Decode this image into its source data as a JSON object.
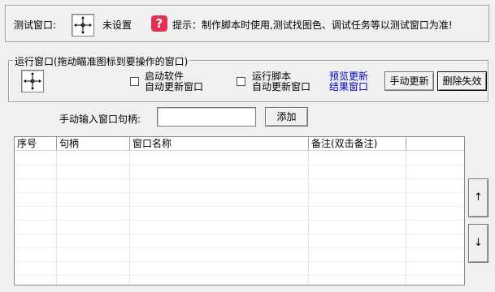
{
  "top": {
    "test_window_label": "测试窗口:",
    "crosshair_icon": "crosshair-icon",
    "not_set_text": "未设置",
    "help_icon": "question-icon",
    "help_icon_glyph": "?",
    "help_icon_color": "#e0314f",
    "hint_text": "提示：制作脚本时使用,测试找图色、调试任务等以测试窗口为准!"
  },
  "run_window": {
    "legend": "运行窗口(拖动瞄准图标到要操作的窗口)",
    "crosshair_icon": "crosshair-icon",
    "checkbox_start_software": {
      "line1": "启动软件",
      "line2": "自动更新窗口",
      "checked": false
    },
    "checkbox_run_script": {
      "line1": "运行脚本",
      "line2": "自动更新窗口",
      "checked": false
    },
    "preview_link": {
      "line1": "预览更新",
      "line2": "结果窗口",
      "color": "#0000c0"
    },
    "manual_update_button": "手动更新",
    "delete_invalid_button": "删除失效"
  },
  "manual_input": {
    "label": "手动输入窗口句柄:",
    "value": "",
    "add_button": "添加"
  },
  "table": {
    "columns": [
      "序号",
      "句柄",
      "窗口名称",
      "备注(双击备注)",
      ""
    ],
    "rows": []
  },
  "side_buttons": {
    "up": "↑",
    "down": "↓"
  }
}
